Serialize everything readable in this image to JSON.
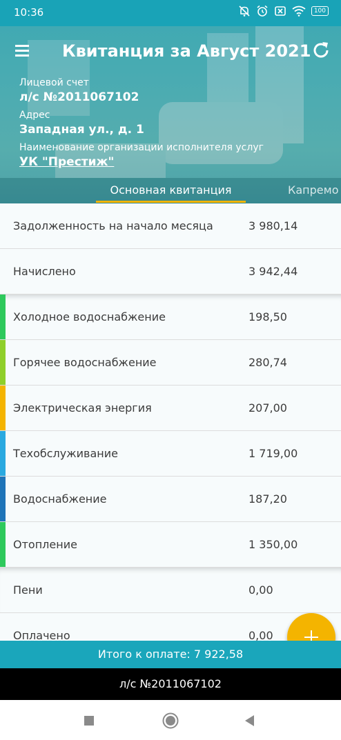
{
  "status_bar": {
    "time": "10:36",
    "battery": "100",
    "icons": [
      "bell-off-icon",
      "alarm-icon",
      "sim-off-icon",
      "wifi-icon",
      "battery-icon"
    ]
  },
  "header": {
    "title": "Квитанция за Август 2021",
    "account_label": "Лицевой счет",
    "account_value": "л/с №2011067102",
    "address_label": "Адрес",
    "address_value": "Западная ул., д. 1",
    "org_label": "Наименование организации исполнителя услуг",
    "org_value": "УК \"Престиж\""
  },
  "tabs": [
    {
      "label": "Основная квитанция",
      "active": true
    },
    {
      "label": "Капремо",
      "active": false
    }
  ],
  "rows": [
    {
      "name": "Задолженность на начало месяца",
      "amount": "3 980,14",
      "color": ""
    },
    {
      "name": "Начислено",
      "amount": "3 942,44",
      "color": ""
    },
    {
      "name": "Холодное водоснабжение",
      "amount": "198,50",
      "color": "#2ec95c"
    },
    {
      "name": "Горячее водоснабжение",
      "amount": "280,74",
      "color": "#8fcf2a"
    },
    {
      "name": "Электрическая энергия",
      "amount": "207,00",
      "color": "#f4b400"
    },
    {
      "name": "Техобслуживание",
      "amount": "1 719,00",
      "color": "#2aa9e0"
    },
    {
      "name": "Водоснабжение",
      "amount": "187,20",
      "color": "#1f74b8"
    },
    {
      "name": "Отопление",
      "amount": "1 350,00",
      "color": "#2ec95c"
    },
    {
      "name": "Пени",
      "amount": "0,00",
      "color": ""
    },
    {
      "name": "Оплачено",
      "amount": "0,00",
      "color": ""
    }
  ],
  "total": "Итого к оплате: 7 922,58",
  "account_footer": "л/с №2011067102",
  "colors": {
    "accent": "#1aa6bb",
    "fab": "#f4b400"
  }
}
